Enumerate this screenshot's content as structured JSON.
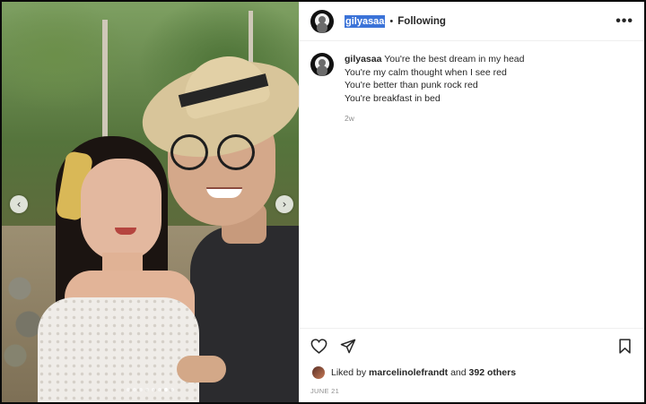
{
  "header": {
    "username": "gilyasaa",
    "separator": "•",
    "follow_status": "Following",
    "more_label": "•••"
  },
  "caption": {
    "username": "gilyasaa",
    "lines": [
      "You're the best dream in my head",
      "You're my calm thought when I see red",
      "You're better than punk rock red",
      "You're breakfast in bed"
    ],
    "time_ago": "2w"
  },
  "media": {
    "prev_label": "‹",
    "next_label": "›",
    "dots_count": 8,
    "active_dot": 7
  },
  "likes": {
    "prefix": "Liked by",
    "user": "marcelinolefrandt",
    "and": "and",
    "others": "392 others"
  },
  "date": "JUNE 21",
  "icons": [
    "heart-icon",
    "share-icon",
    "bookmark-icon",
    "more-icon"
  ]
}
